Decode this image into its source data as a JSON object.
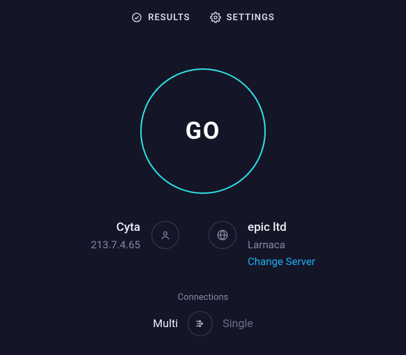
{
  "nav": {
    "results": "RESULTS",
    "settings": "SETTINGS"
  },
  "go_label": "GO",
  "client": {
    "isp": "Cyta",
    "ip": "213.7.4.65"
  },
  "server": {
    "provider": "epic ltd",
    "city": "Larnaca",
    "change_label": "Change Server"
  },
  "connections": {
    "label": "Connections",
    "multi": "Multi",
    "single": "Single"
  }
}
